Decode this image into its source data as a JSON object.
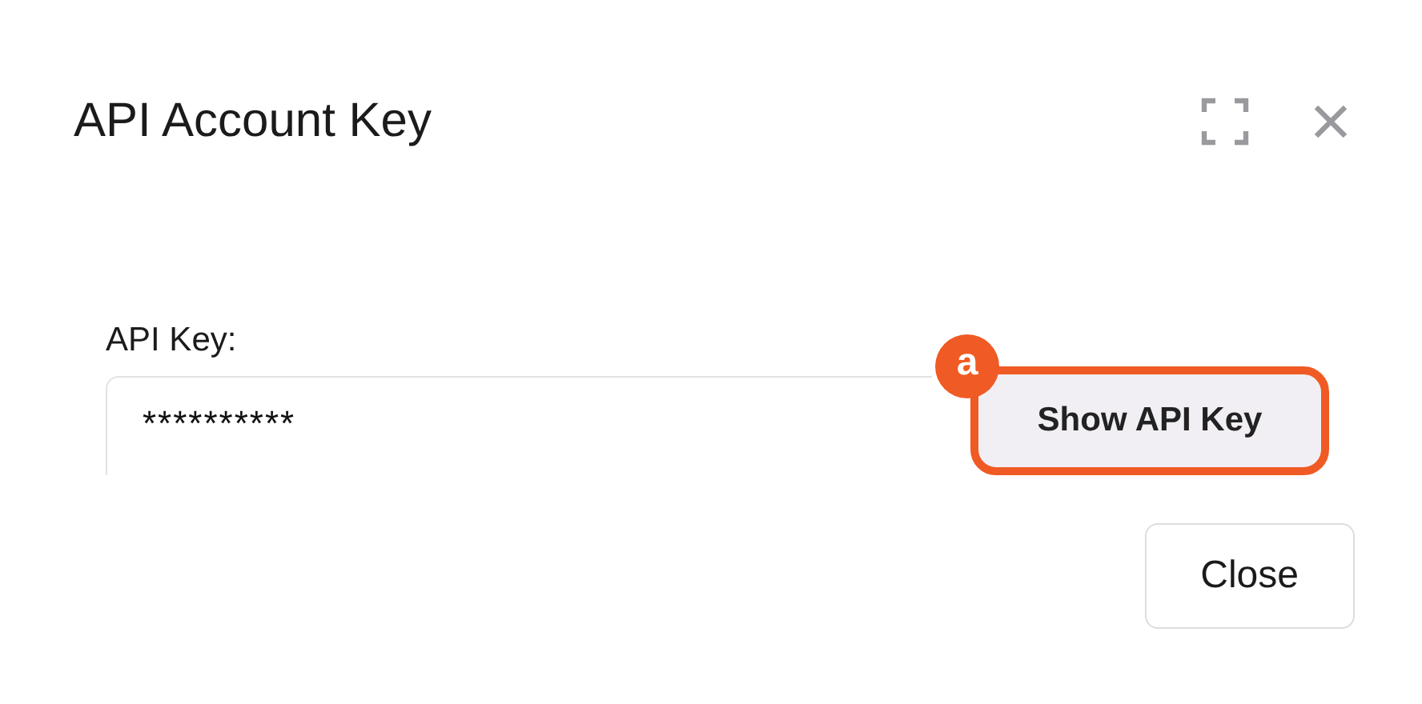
{
  "dialog": {
    "title": "API Account Key"
  },
  "field": {
    "label": "API Key:",
    "value": "**********"
  },
  "show_button": {
    "label": "Show API Key",
    "highlighted": true,
    "marker": "a"
  },
  "close_button": {
    "label": "Close"
  }
}
